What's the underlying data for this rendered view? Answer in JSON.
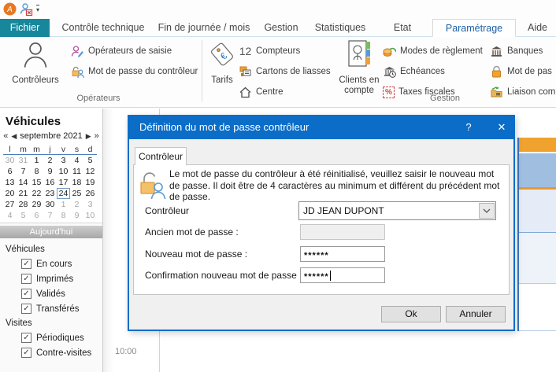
{
  "tabs": [
    {
      "label": "Fichier"
    },
    {
      "label": "Contrôle technique"
    },
    {
      "label": "Fin de journée / mois"
    },
    {
      "label": "Gestion"
    },
    {
      "label": "Statistiques"
    },
    {
      "label": "Etat"
    },
    {
      "label": "Paramétrage"
    },
    {
      "label": "Aide"
    }
  ],
  "ribbon": {
    "groups": [
      {
        "label": "Opérateurs"
      },
      {
        "label": "Gestion"
      }
    ],
    "buttons": {
      "controleurs": "Contrôleurs",
      "operateurs_saisie": "Opérateurs de saisie",
      "mdp_controleur": "Mot de passe du contrôleur",
      "tarifs": "Tarifs",
      "compteurs_badge": "12",
      "compteurs": "Compteurs",
      "cartons": "Cartons de liasses",
      "centre": "Centre",
      "clients_line1": "Clients en",
      "clients_line2": "compte",
      "modes_reglement": "Modes de règlement",
      "echeances": "Echéances",
      "taxes_fiscales": "Taxes fiscales",
      "banques": "Banques",
      "mot_de_passe": "Mot de pas",
      "liaison": "Liaison com"
    }
  },
  "sidebar": {
    "title": "Véhicules",
    "calendar": {
      "nav_prev_year": "«",
      "nav_prev": "◀",
      "month": "septembre 2021",
      "nav_next": "▶",
      "nav_next_year": "»",
      "day_headers": [
        "l",
        "m",
        "m",
        "j",
        "v",
        "s",
        "d"
      ],
      "weeks": [
        [
          {
            "d": 30,
            "m": true
          },
          {
            "d": 31,
            "m": true
          },
          {
            "d": 1
          },
          {
            "d": 2
          },
          {
            "d": 3
          },
          {
            "d": 4
          },
          {
            "d": 5
          }
        ],
        [
          {
            "d": 6
          },
          {
            "d": 7
          },
          {
            "d": 8
          },
          {
            "d": 9
          },
          {
            "d": 10
          },
          {
            "d": 11
          },
          {
            "d": 12
          }
        ],
        [
          {
            "d": 13
          },
          {
            "d": 14
          },
          {
            "d": 15
          },
          {
            "d": 16
          },
          {
            "d": 17
          },
          {
            "d": 18
          },
          {
            "d": 19
          }
        ],
        [
          {
            "d": 20
          },
          {
            "d": 21
          },
          {
            "d": 22
          },
          {
            "d": 23
          },
          {
            "d": 24,
            "t": true
          },
          {
            "d": 25
          },
          {
            "d": 26
          }
        ],
        [
          {
            "d": 27
          },
          {
            "d": 28
          },
          {
            "d": 29
          },
          {
            "d": 30
          },
          {
            "d": 1,
            "m": true
          },
          {
            "d": 2,
            "m": true
          },
          {
            "d": 3,
            "m": true
          }
        ],
        [
          {
            "d": 4,
            "m": true
          },
          {
            "d": 5,
            "m": true
          },
          {
            "d": 6,
            "m": true
          },
          {
            "d": 7,
            "m": true
          },
          {
            "d": 8,
            "m": true
          },
          {
            "d": 9,
            "m": true
          },
          {
            "d": 10,
            "m": true
          }
        ]
      ]
    },
    "today_button": "Aujourd'hui",
    "sections": [
      {
        "label": "Véhicules",
        "items": [
          {
            "label": "En cours",
            "checked": true
          },
          {
            "label": "Imprimés",
            "checked": true
          },
          {
            "label": "Validés",
            "checked": true
          },
          {
            "label": "Transférés",
            "checked": true
          }
        ]
      },
      {
        "label": "Visites",
        "items": [
          {
            "label": "Périodiques",
            "checked": true
          },
          {
            "label": "Contre-visites",
            "checked": true
          }
        ]
      }
    ]
  },
  "scheduler": {
    "time_label": "10:00",
    "colors": {
      "header_orange": "#F0A22E",
      "row_steelblue": "#A0BEE0",
      "row_lavender": "#E5EBF7",
      "row_pale": "#EEF2F9"
    }
  },
  "dialog": {
    "title": "Définition du mot de passe contrôleur",
    "help_glyph": "?",
    "close_glyph": "✕",
    "tab": "Contrôleur",
    "message": "Le mot de passe du contrôleur à été réinitialisé, veuillez saisir le nouveau mot de passe. Il doit être de 4 caractères au minimum et différent du précédent mot de passe.",
    "fields": {
      "controleur_label": "Contrôleur",
      "controleur_value": "JD JEAN DUPONT",
      "ancien_label": "Ancien mot de passe :",
      "ancien_value": "",
      "nouveau_label": "Nouveau mot de passe :",
      "nouveau_value": "******",
      "confirmation_label": "Confirmation nouveau mot de passe :",
      "confirmation_value": "******"
    },
    "buttons": {
      "ok": "Ok",
      "cancel": "Annuler"
    }
  }
}
